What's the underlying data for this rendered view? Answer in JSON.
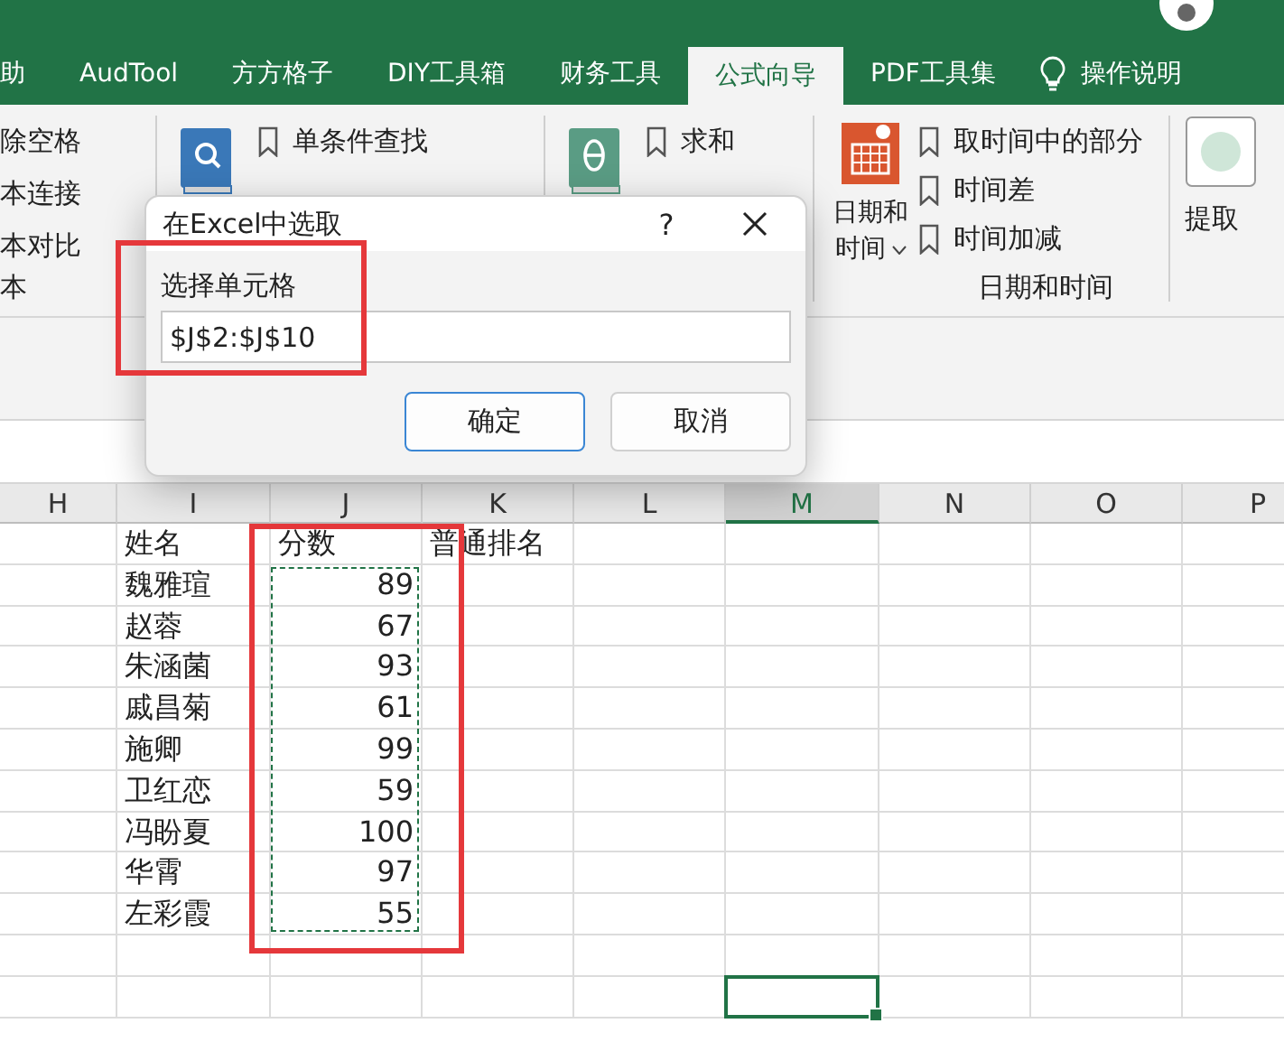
{
  "tabs": [
    {
      "label": "助",
      "selected": false
    },
    {
      "label": "AudTool",
      "selected": false
    },
    {
      "label": "方方格子",
      "selected": false
    },
    {
      "label": "DIY工具箱",
      "selected": false
    },
    {
      "label": "财务工具",
      "selected": false
    },
    {
      "label": "公式向导",
      "selected": true
    },
    {
      "label": "PDF工具集",
      "selected": false
    }
  ],
  "tell_me": "操作说明",
  "ribbon": {
    "groups": [
      {
        "kind": "list",
        "items": [
          "除空格",
          "本连接",
          "本对比"
        ],
        "label": "本"
      },
      {
        "kind": "lookup",
        "items": [
          "单条件查找"
        ]
      },
      {
        "kind": "math",
        "items": [
          "求和"
        ]
      },
      {
        "kind": "date",
        "button": [
          "日期和",
          "时间"
        ],
        "items": [
          "取时间中的部分",
          "时间差",
          "时间加减"
        ],
        "label": "日期和时间"
      },
      {
        "kind": "partial",
        "button": "提取"
      }
    ]
  },
  "sheet": {
    "columns": [
      {
        "label": "H",
        "selected": false
      },
      {
        "label": "I",
        "selected": false
      },
      {
        "label": "J",
        "selected": false
      },
      {
        "label": "K",
        "selected": false
      },
      {
        "label": "L",
        "selected": false
      },
      {
        "label": "M",
        "selected": true
      },
      {
        "label": "N",
        "selected": false
      },
      {
        "label": "O",
        "selected": false
      },
      {
        "label": "P",
        "selected": false
      }
    ],
    "header": {
      "name": "姓名",
      "score": "分数",
      "rank": "普通排名"
    },
    "rows": [
      {
        "name": "魏雅瑄",
        "score": "89"
      },
      {
        "name": "赵蓉",
        "score": "67"
      },
      {
        "name": "朱涵菌",
        "score": "93"
      },
      {
        "name": "戚昌菊",
        "score": "61"
      },
      {
        "name": "施卿",
        "score": "99"
      },
      {
        "name": "卫红恋",
        "score": "59"
      },
      {
        "name": "冯盼夏",
        "score": "100"
      },
      {
        "name": "华霄",
        "score": "97"
      },
      {
        "name": "左彩霞",
        "score": "55"
      }
    ],
    "copy_range": true,
    "highlighted": true
  },
  "dialog": {
    "title": "在Excel中选取",
    "help": "?",
    "label": "选择单元格",
    "value": "$J$2:$J$10",
    "highlighted": true,
    "buttons": [
      {
        "label": "确定",
        "selected": true
      },
      {
        "label": "取消",
        "selected": false
      }
    ]
  }
}
